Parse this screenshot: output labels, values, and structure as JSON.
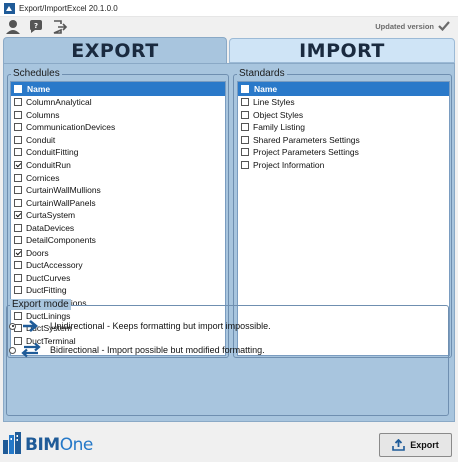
{
  "window": {
    "title": "Export/ImportExcel 20.1.0.0"
  },
  "toolbar": {
    "icons": [
      "user-icon",
      "help-chat-icon",
      "logout-icon"
    ],
    "updated_label": "Updated version"
  },
  "tabs": [
    {
      "label": "EXPORT",
      "active": true
    },
    {
      "label": "IMPORT",
      "active": false
    }
  ],
  "schedules": {
    "legend": "Schedules",
    "header": "Name",
    "items": [
      {
        "label": "ColumnAnalytical",
        "checked": false
      },
      {
        "label": "Columns",
        "checked": false
      },
      {
        "label": "CommunicationDevices",
        "checked": false
      },
      {
        "label": "Conduit",
        "checked": false
      },
      {
        "label": "ConduitFitting",
        "checked": false
      },
      {
        "label": "ConduitRun",
        "checked": true
      },
      {
        "label": "Cornices",
        "checked": false
      },
      {
        "label": "CurtainWallMullions",
        "checked": false
      },
      {
        "label": "CurtainWallPanels",
        "checked": false
      },
      {
        "label": "CurtaSystem",
        "checked": true
      },
      {
        "label": "DataDevices",
        "checked": false
      },
      {
        "label": "DetailComponents",
        "checked": false
      },
      {
        "label": "Doors",
        "checked": true
      },
      {
        "label": "DuctAccessory",
        "checked": false
      },
      {
        "label": "DuctCurves",
        "checked": false
      },
      {
        "label": "DuctFitting",
        "checked": false
      },
      {
        "label": "DuctInsultations",
        "checked": false
      },
      {
        "label": "DuctLinings",
        "checked": false
      },
      {
        "label": "DuctSystem",
        "checked": false
      },
      {
        "label": "DuctTerminal",
        "checked": false
      }
    ]
  },
  "standards": {
    "legend": "Standards",
    "header": "Name",
    "items": [
      {
        "label": "Line Styles",
        "checked": false
      },
      {
        "label": "Object Styles",
        "checked": false
      },
      {
        "label": "Family Listing",
        "checked": false
      },
      {
        "label": "Shared Parameters Settings",
        "checked": false
      },
      {
        "label": "Project Parameters Settings",
        "checked": false
      },
      {
        "label": "Project Information",
        "checked": false
      }
    ]
  },
  "export_mode": {
    "legend": "Export mode",
    "options": [
      {
        "label": "Unidirectional - Keeps formatting but import impossible.",
        "selected": true
      },
      {
        "label": "Bidirectional - Import possible but modified formatting.",
        "selected": false
      }
    ]
  },
  "footer": {
    "logo_bim": "BIM",
    "logo_one": "One",
    "export_button": "Export"
  },
  "colors": {
    "panel": "#a8c5de",
    "header": "#2a79c9",
    "accent": "#1f5b98"
  }
}
